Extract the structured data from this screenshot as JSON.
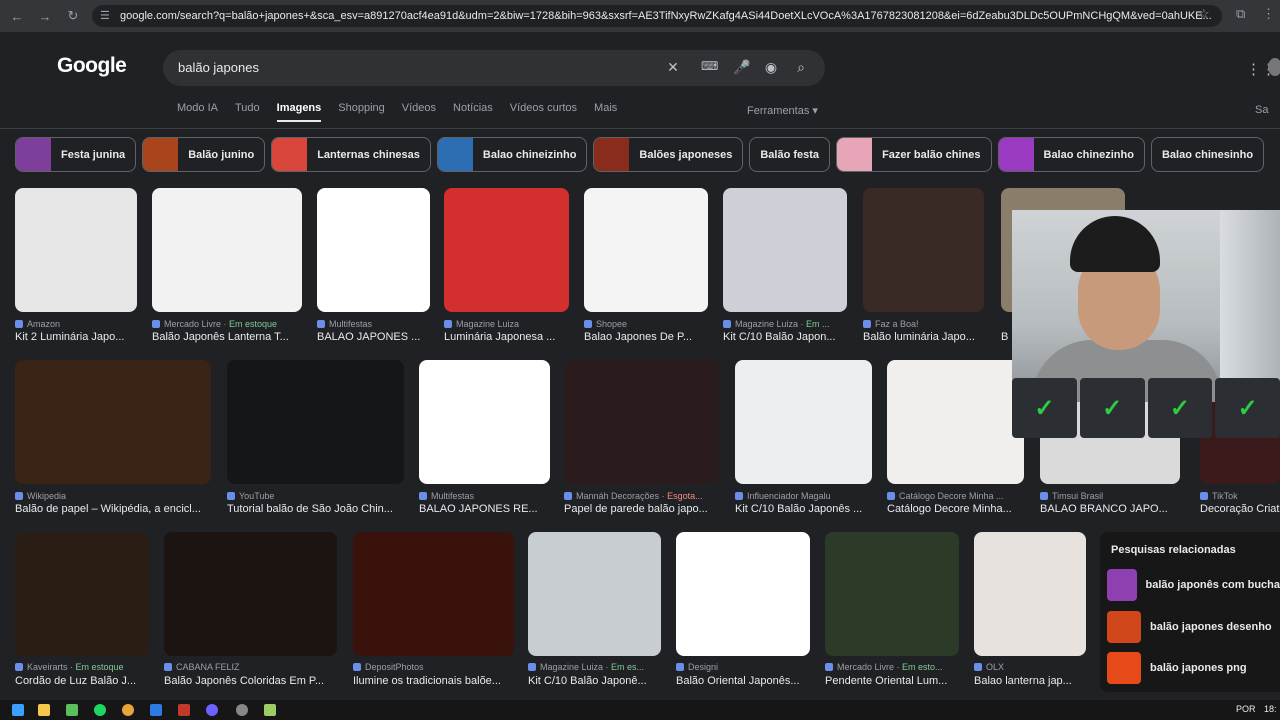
{
  "browser": {
    "url": "google.com/search?q=balão+japones+&sca_esv=a891270acf4ea91d&udm=2&biw=1728&bih=963&sxsrf=AE3TifNxyRwZKafg4ASi44DoetXLcVOcA%3A1767823081208&ei=6dZeabu3DLDc5OUPmNCHgQM&ved=0ahUKE..."
  },
  "header": {
    "logo": "Google",
    "search_value": "balão japones"
  },
  "tabs": [
    "Modo IA",
    "Tudo",
    "Imagens",
    "Shopping",
    "Vídeos",
    "Notícias",
    "Vídeos curtos",
    "Mais"
  ],
  "tools_label": "Ferramentas",
  "saf_label": "Sa",
  "chips": [
    {
      "label": "Festa junina",
      "color": "#7e3f9c"
    },
    {
      "label": "Balão junino",
      "color": "#a8451c"
    },
    {
      "label": "Lanternas chinesas",
      "color": "#d9463c"
    },
    {
      "label": "Balao chineizinho",
      "color": "#2c6db3"
    },
    {
      "label": "Balões japoneses",
      "color": "#8a2c1c"
    },
    {
      "label": "Balão festa",
      "color": ""
    },
    {
      "label": "Fazer balão chines",
      "color": "#e7a6b8"
    },
    {
      "label": "Balao chinezinho",
      "color": "#9b3bc1"
    },
    {
      "label": "Balao chinesinho",
      "color": ""
    }
  ],
  "row1": [
    {
      "source": "Amazon",
      "extra": "",
      "title": "Kit 2 Luminária Japo...",
      "color": "#e6e6e6"
    },
    {
      "source": "Mercado Livre",
      "extra": "Em estoque",
      "title": "Balão Japonês Lanterna T...",
      "color": "#f2f2f2"
    },
    {
      "source": "Multifestas",
      "extra": "",
      "title": "BALAO JAPONES ...",
      "color": "#ffffff"
    },
    {
      "source": "Magazine Luiza",
      "extra": "",
      "title": "Luminária Japonesa ...",
      "color": "#d32f2f"
    },
    {
      "source": "Shopee",
      "extra": "",
      "title": "Balao Japones De P...",
      "color": "#f4f4f4"
    },
    {
      "source": "Magazine Luiza",
      "extra": "Em ...",
      "title": "Kit C/10 Balão Japon...",
      "color": "#cfcfd8"
    },
    {
      "source": "Faz a Boa!",
      "extra": "",
      "title": "Balão luminária Japo...",
      "color": "#3a2a26"
    },
    {
      "source": "",
      "extra": "",
      "title": "B",
      "color": "#8a7d6a"
    }
  ],
  "row2": [
    {
      "source": "Wikipedia",
      "extra": "",
      "title": "Balão de papel – Wikipédia, a encicl...",
      "color": "#3a2416"
    },
    {
      "source": "YouTube",
      "extra": "",
      "title": "Tutorial balão de São João Chin...",
      "color": "#141618"
    },
    {
      "source": "Multifestas",
      "extra": "",
      "title": "BALAO JAPONES RE...",
      "color": "#ffffff"
    },
    {
      "source": "Mannáh Decorações",
      "extra": "Esgota...",
      "title": "Papel de parede balão japo...",
      "color": "#2a1c1c"
    },
    {
      "source": "Influenciador Magalu",
      "extra": "",
      "title": "Kit C/10 Balão Japonês ...",
      "color": "#eceef0"
    },
    {
      "source": "Catálogo Decore Minha ...",
      "extra": "",
      "title": "Catálogo Decore Minha...",
      "color": "#f0efed"
    },
    {
      "source": "Timsui Brasil",
      "extra": "",
      "title": "BALAO BRANCO JAPO...",
      "color": "#dadada"
    },
    {
      "source": "TikTok",
      "extra": "",
      "title": "Decoração Criativ",
      "color": "#3a1a1a"
    }
  ],
  "row3": [
    {
      "source": "Kaveirarts",
      "extra": "Em estoque",
      "title": "Cordão de Luz Balão J...",
      "color": "#2a1e14"
    },
    {
      "source": "CABANA FELIZ",
      "extra": "",
      "title": "Balão Japonês Coloridas Em P...",
      "color": "#1c1410"
    },
    {
      "source": "DepositPhotos",
      "extra": "",
      "title": "Ilumine os tradicionais balõe...",
      "color": "#3a120c"
    },
    {
      "source": "Magazine Luiza",
      "extra": "Em es...",
      "title": "Kit C/10 Balão Japonê...",
      "color": "#c8cdd2"
    },
    {
      "source": "Designi",
      "extra": "",
      "title": "Balão Oriental Japonês...",
      "color": "#ffffff"
    },
    {
      "source": "Mercado Livre",
      "extra": "Em esto...",
      "title": "Pendente Oriental Lum...",
      "color": "#2c3a28"
    },
    {
      "source": "OLX",
      "extra": "",
      "title": "Balao lanterna jap...",
      "color": "#e7e2de"
    }
  ],
  "related": {
    "heading": "Pesquisas relacionadas",
    "items": [
      "balão japonês com bucha",
      "balão japones desenho",
      "balão japones png"
    ]
  },
  "taskbar": {
    "lang": "POR",
    "time": "18:"
  }
}
